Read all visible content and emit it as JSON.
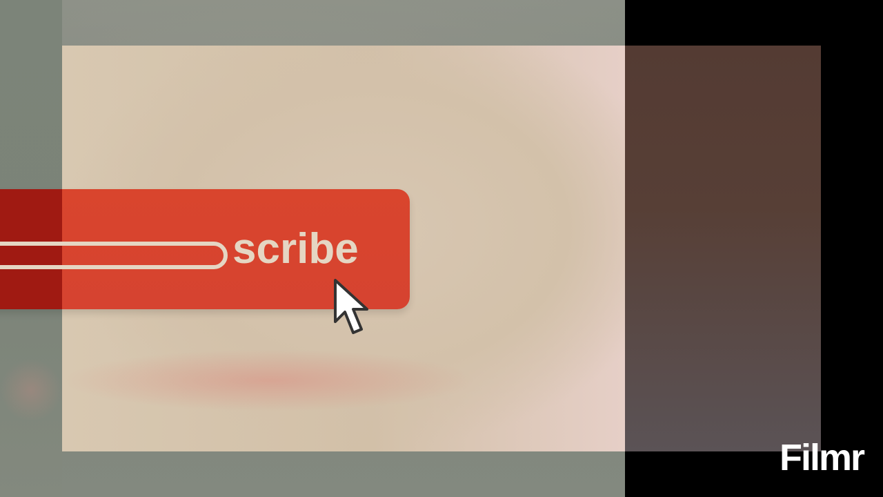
{
  "video_frame": {
    "button_text": "scribe",
    "watermark": "Filmr"
  },
  "colors": {
    "button_red": "#d9452d",
    "text_beige": "#e5d6c3",
    "panel_beige": "#d3c1aa",
    "watermark_white": "#ffffff"
  },
  "icons": {
    "cursor": "mouse-pointer-icon"
  }
}
